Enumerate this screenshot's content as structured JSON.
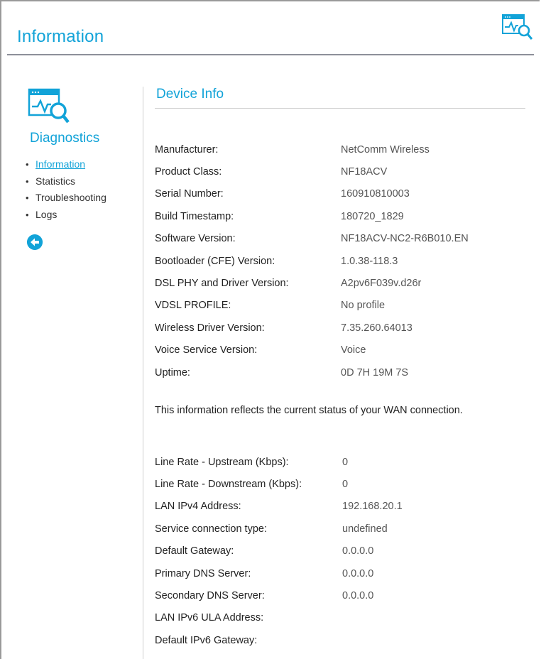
{
  "header": {
    "title": "Information",
    "icon": "diagnostics-icon"
  },
  "sidebar": {
    "title": "Diagnostics",
    "items": [
      {
        "label": "Information",
        "active": true
      },
      {
        "label": "Statistics",
        "active": false
      },
      {
        "label": "Troubleshooting",
        "active": false
      },
      {
        "label": "Logs",
        "active": false
      }
    ],
    "back_icon": "back-arrow-icon"
  },
  "device_info": {
    "title": "Device Info",
    "rows": [
      {
        "label": "Manufacturer:",
        "value": "NetComm Wireless"
      },
      {
        "label": "Product Class:",
        "value": "NF18ACV"
      },
      {
        "label": "Serial Number:",
        "value": "160910810003"
      },
      {
        "label": "Build Timestamp:",
        "value": "180720_1829"
      },
      {
        "label": "Software Version:",
        "value": "NF18ACV-NC2-R6B010.EN"
      },
      {
        "label": "Bootloader (CFE) Version:",
        "value": "1.0.38-118.3"
      },
      {
        "label": "DSL PHY and Driver Version:",
        "value": "A2pv6F039v.d26r"
      },
      {
        "label": "VDSL PROFILE:",
        "value": "No profile"
      },
      {
        "label": "Wireless Driver Version:",
        "value": "7.35.260.64013"
      },
      {
        "label": "Voice Service Version:",
        "value": "Voice"
      },
      {
        "label": "Uptime:",
        "value": "0D 7H 19M 7S"
      }
    ],
    "wan_note": "This information reflects the current status of your WAN connection.",
    "wan_rows": [
      {
        "label": "Line Rate - Upstream (Kbps):",
        "value": "0"
      },
      {
        "label": "Line Rate - Downstream (Kbps):",
        "value": "0"
      },
      {
        "label": "LAN IPv4 Address:",
        "value": "192.168.20.1"
      },
      {
        "label": "Service connection type:",
        "value": "undefined"
      },
      {
        "label": "Default Gateway:",
        "value": "0.0.0.0"
      },
      {
        "label": "Primary DNS Server:",
        "value": "0.0.0.0"
      },
      {
        "label": "Secondary DNS Server:",
        "value": "0.0.0.0"
      },
      {
        "label": "LAN IPv6 ULA Address:",
        "value": ""
      },
      {
        "label": "Default IPv6 Gateway:",
        "value": ""
      }
    ]
  },
  "colors": {
    "accent": "#12a3d8",
    "rule": "#8d8f99"
  }
}
